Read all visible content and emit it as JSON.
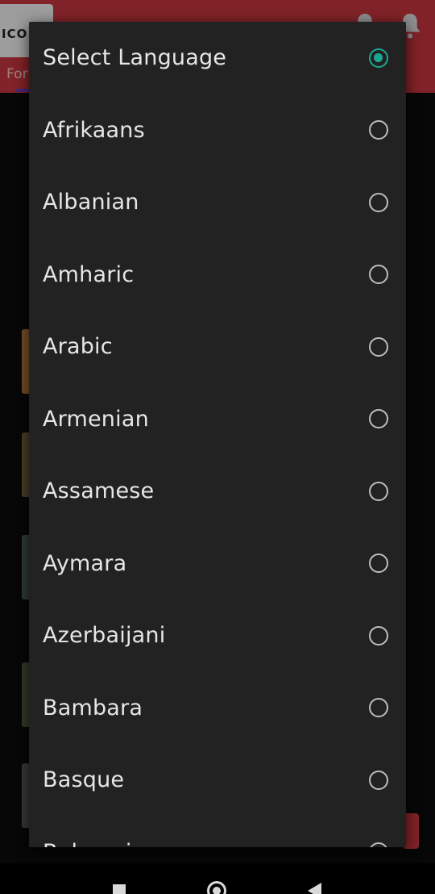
{
  "app": {
    "logo_text": "ICO",
    "header_tab_label": "For"
  },
  "dialog": {
    "title": "Select Language",
    "selected_index": 0,
    "options": [
      {
        "label": "Select Language",
        "checked": true
      },
      {
        "label": "Afrikaans",
        "checked": false
      },
      {
        "label": "Albanian",
        "checked": false
      },
      {
        "label": "Amharic",
        "checked": false
      },
      {
        "label": "Arabic",
        "checked": false
      },
      {
        "label": "Armenian",
        "checked": false
      },
      {
        "label": "Assamese",
        "checked": false
      },
      {
        "label": "Aymara",
        "checked": false
      },
      {
        "label": "Azerbaijani",
        "checked": false
      },
      {
        "label": "Bambara",
        "checked": false
      },
      {
        "label": "Basque",
        "checked": false
      },
      {
        "label": "Belarusian",
        "checked": false
      }
    ]
  },
  "colors": {
    "header": "#c7373e",
    "dialog_bg": "#222222",
    "radio_checked": "#1aa893",
    "radio_unchecked": "#bdbdbd",
    "text": "#e6e6e6"
  },
  "navbar": {
    "recents_icon": "square-icon",
    "home_icon": "circle-home-icon",
    "back_icon": "triangle-back-icon"
  }
}
